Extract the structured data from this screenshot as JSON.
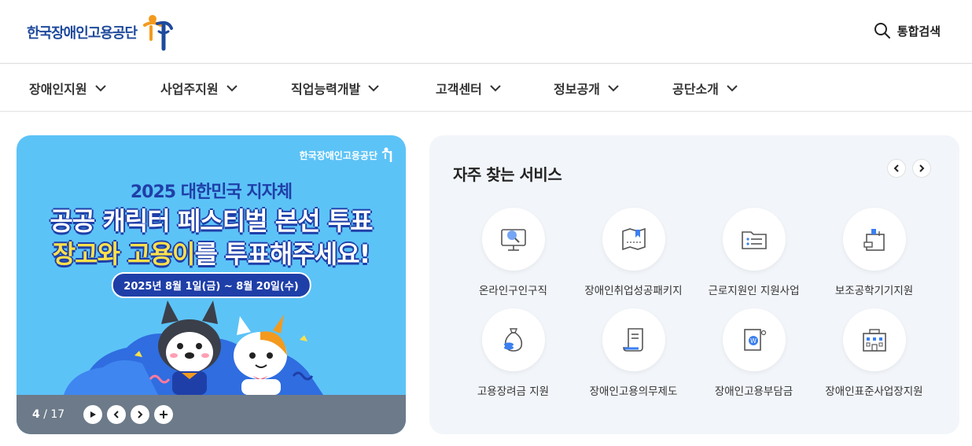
{
  "header": {
    "logo_text": "한국장애인고용공단",
    "search_label": "통합검색"
  },
  "nav": {
    "items": [
      {
        "label": "장애인지원"
      },
      {
        "label": "사업주지원"
      },
      {
        "label": "직업능력개발"
      },
      {
        "label": "고객센터"
      },
      {
        "label": "정보공개"
      },
      {
        "label": "공단소개"
      }
    ]
  },
  "banner": {
    "logo_text": "한국장애인고용공단",
    "line1": "2025 대한민국 지자체",
    "line2": "공공 캐릭터 페스티벌 본선 투표",
    "line3_highlight": "장고와 고용이",
    "line3_rest": "를 투표해주세요!",
    "date": "2025년 8월 1일(금) ~ 8월 20일(수)",
    "counter_current": "4",
    "counter_separator": "/",
    "counter_total": "17"
  },
  "services": {
    "title": "자주 찾는 서비스",
    "items": [
      {
        "label": "온라인구인구직",
        "icon": "job-search-monitor-icon"
      },
      {
        "label": "장애인취업성공패키지",
        "icon": "map-bookmark-icon"
      },
      {
        "label": "근로지원인 지원사업",
        "icon": "id-folder-icon"
      },
      {
        "label": "보조공학기기지원",
        "icon": "assistive-device-icon"
      },
      {
        "label": "고용장려금 지원",
        "icon": "money-bag-icon"
      },
      {
        "label": "장애인고용의무제도",
        "icon": "document-scroll-icon"
      },
      {
        "label": "장애인고용부담금",
        "icon": "levy-document-icon"
      },
      {
        "label": "장애인표준사업장지원",
        "icon": "building-icon"
      }
    ]
  },
  "colors": {
    "brand_blue": "#1e4a9c",
    "brand_orange": "#f39a1e",
    "banner_bg": "#5cc3f7",
    "service_panel_bg": "#f2f5f9"
  }
}
